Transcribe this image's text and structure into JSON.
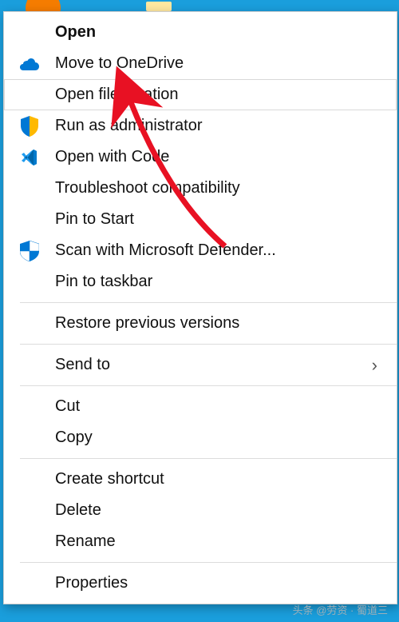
{
  "menu": {
    "items": [
      {
        "label": "Open",
        "bold": true,
        "icon": null
      },
      {
        "label": "Move to OneDrive",
        "icon": "onedrive-icon"
      },
      {
        "label": "Open file location",
        "icon": null,
        "selected": true
      },
      {
        "label": "Run as administrator",
        "icon": "shield-icon"
      },
      {
        "label": "Open with Code",
        "icon": "vscode-icon"
      },
      {
        "label": "Troubleshoot compatibility",
        "icon": null
      },
      {
        "label": "Pin to Start",
        "icon": null
      },
      {
        "label": "Scan with Microsoft Defender...",
        "icon": "defender-icon"
      },
      {
        "label": "Pin to taskbar",
        "icon": null
      }
    ],
    "group2": [
      {
        "label": "Restore previous versions"
      }
    ],
    "group3": [
      {
        "label": "Send to",
        "submenu": true
      }
    ],
    "group4": [
      {
        "label": "Cut"
      },
      {
        "label": "Copy"
      }
    ],
    "group5": [
      {
        "label": "Create shortcut"
      },
      {
        "label": "Delete"
      },
      {
        "label": "Rename"
      }
    ],
    "group6": [
      {
        "label": "Properties"
      }
    ]
  },
  "watermark": "头条 @劳资 · 蜀道三"
}
